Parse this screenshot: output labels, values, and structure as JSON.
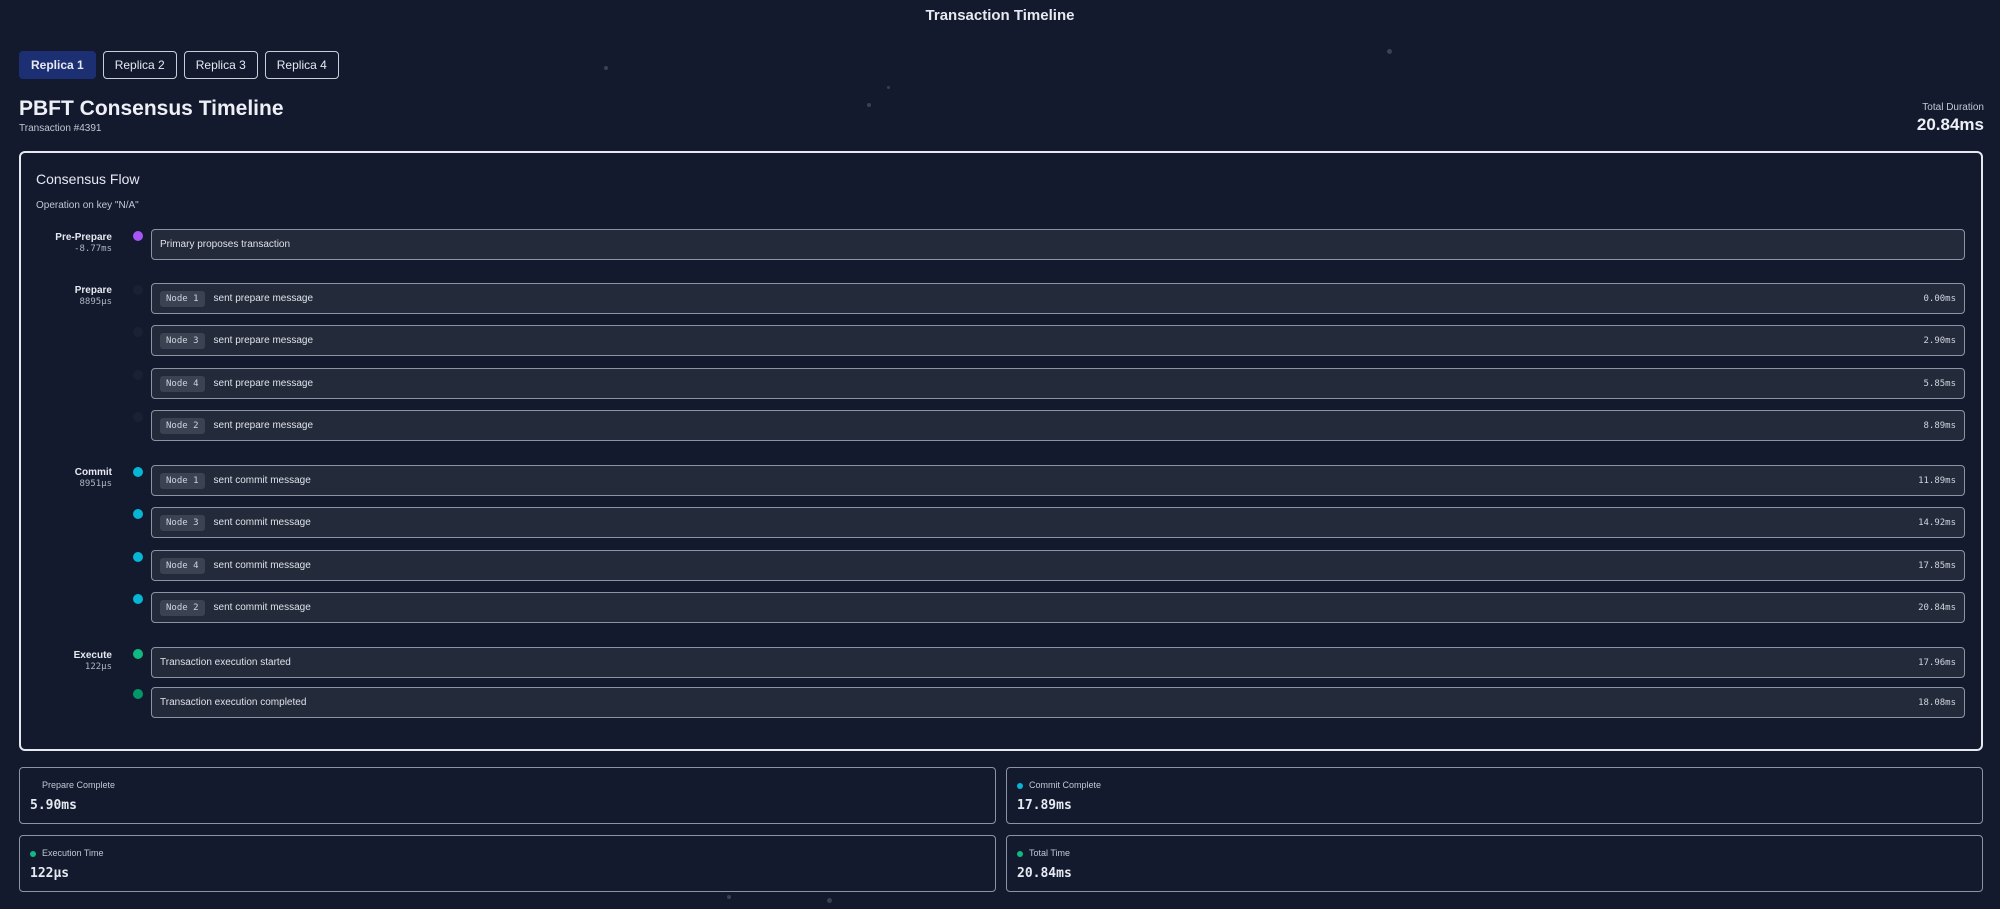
{
  "app_title": "Transaction Timeline",
  "tabs": [
    {
      "label": "Replica 1",
      "active": true
    },
    {
      "label": "Replica 2",
      "active": false
    },
    {
      "label": "Replica 3",
      "active": false
    },
    {
      "label": "Replica 4",
      "active": false
    }
  ],
  "header": {
    "title": "PBFT Consensus Timeline",
    "subtitle": "Transaction #4391",
    "duration_label": "Total Duration",
    "duration_value": "20.84ms"
  },
  "flow": {
    "title": "Consensus Flow",
    "subtitle": "Operation on key \"N/A\"",
    "phases": [
      {
        "name": "Pre-Prepare",
        "time": "-8.77ms"
      },
      {
        "name": "Prepare",
        "time": "8895µs"
      },
      {
        "name": "Commit",
        "time": "8951µs"
      },
      {
        "name": "Execute",
        "time": "122µs"
      }
    ],
    "events": [
      {
        "node": "",
        "text": "Primary proposes transaction",
        "time": ""
      },
      {
        "node": "Node 1",
        "text": "sent prepare message",
        "time": "0.00ms"
      },
      {
        "node": "Node 3",
        "text": "sent prepare message",
        "time": "2.90ms"
      },
      {
        "node": "Node 4",
        "text": "sent prepare message",
        "time": "5.85ms"
      },
      {
        "node": "Node 2",
        "text": "sent prepare message",
        "time": "8.89ms"
      },
      {
        "node": "Node 1",
        "text": "sent commit message",
        "time": "11.89ms"
      },
      {
        "node": "Node 3",
        "text": "sent commit message",
        "time": "14.92ms"
      },
      {
        "node": "Node 4",
        "text": "sent commit message",
        "time": "17.85ms"
      },
      {
        "node": "Node 2",
        "text": "sent commit message",
        "time": "20.84ms"
      },
      {
        "node": "",
        "text": "Transaction execution started",
        "time": "17.96ms"
      },
      {
        "node": "",
        "text": "Transaction execution completed",
        "time": "18.08ms"
      }
    ]
  },
  "stats": [
    {
      "label": "Prepare Complete",
      "value": "5.90ms"
    },
    {
      "label": "Commit Complete",
      "value": "17.89ms"
    },
    {
      "label": "Execution Time",
      "value": "122µs"
    },
    {
      "label": "Total Time",
      "value": "20.84ms"
    }
  ],
  "colors": {
    "background": "#131a2e",
    "tab_active": "#1d2f73",
    "pre_prepare": "#a855f7",
    "prepare": "#1e2538",
    "commit": "#06b6d4",
    "execute_start": "#10b981",
    "execute_done": "#059669",
    "stat_commit": "#06b6d4",
    "stat_exec": "#10b981",
    "stat_total": "#10b981"
  }
}
